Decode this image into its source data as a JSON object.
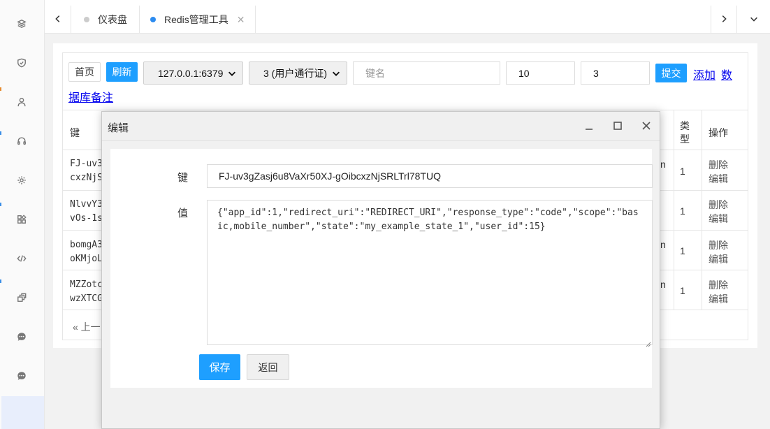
{
  "colors": {
    "accent": "#1e9fff",
    "tab_active_dot": "#2d8cf0",
    "tab_inactive_dot": "#cccccc",
    "link": "#0000ee"
  },
  "sidebar": {
    "items": [
      {
        "icon": "layers-icon"
      },
      {
        "icon": "shield-icon"
      },
      {
        "icon": "user-icon"
      },
      {
        "icon": "headset-icon"
      },
      {
        "icon": "gear-icon"
      },
      {
        "icon": "apps-icon"
      },
      {
        "icon": "code-icon"
      },
      {
        "icon": "stack-icon"
      },
      {
        "icon": "chat-icon"
      },
      {
        "icon": "chat-icon"
      }
    ]
  },
  "tabs": [
    {
      "label": "仪表盘",
      "active": false
    },
    {
      "label": "Redis管理工具",
      "active": true,
      "close": "✕"
    }
  ],
  "toolbar": {
    "home_label": "首页",
    "refresh_label": "刷新",
    "server_select": "127.0.0.1:6379",
    "db_select": "3 (用户通行证)",
    "key_placeholder": "键名",
    "limit_value": "10",
    "db_value": "3",
    "submit_label": "提交",
    "add_link": "添加",
    "db_note_link_part1": "数",
    "db_note_link_part2": "据库备注"
  },
  "table": {
    "headers": {
      "key": "键",
      "type": "类型",
      "actions": "操作"
    },
    "type_header_line1": "类",
    "type_header_line2": "型",
    "rows": [
      {
        "key_line1": "FJ-uv3",
        "key_line2": "cxzNjS",
        "tail": "n",
        "type": "1",
        "delete": "删除",
        "edit": "编辑"
      },
      {
        "key_line1": "NlvvY3",
        "key_line2": "vOs-1s",
        "tail": "",
        "type": "1",
        "delete": "删除",
        "edit": "编辑"
      },
      {
        "key_line1": "bomgA3",
        "key_line2": "oKMjoL",
        "tail": "n",
        "type": "1",
        "delete": "删除",
        "edit": "编辑"
      },
      {
        "key_line1": "MZZotc",
        "key_line2": "wzXTCG",
        "tail": "n",
        "type": "1",
        "delete": "删除",
        "edit": "编辑"
      }
    ],
    "pager_prev": "« 上一"
  },
  "modal": {
    "title": "编辑",
    "key_label": "键",
    "key_value": "FJ-uv3gZasj6u8VaXr50XJ-gOibcxzNjSRLTrl78TUQ",
    "value_label": "值",
    "value_text": "{\"app_id\":1,\"redirect_uri\":\"REDIRECT_URI\",\"response_type\":\"code\",\"scope\":\"basic,mobile_number\",\"state\":\"my_example_state_1\",\"user_id\":15}",
    "save_label": "保存",
    "back_label": "返回"
  }
}
